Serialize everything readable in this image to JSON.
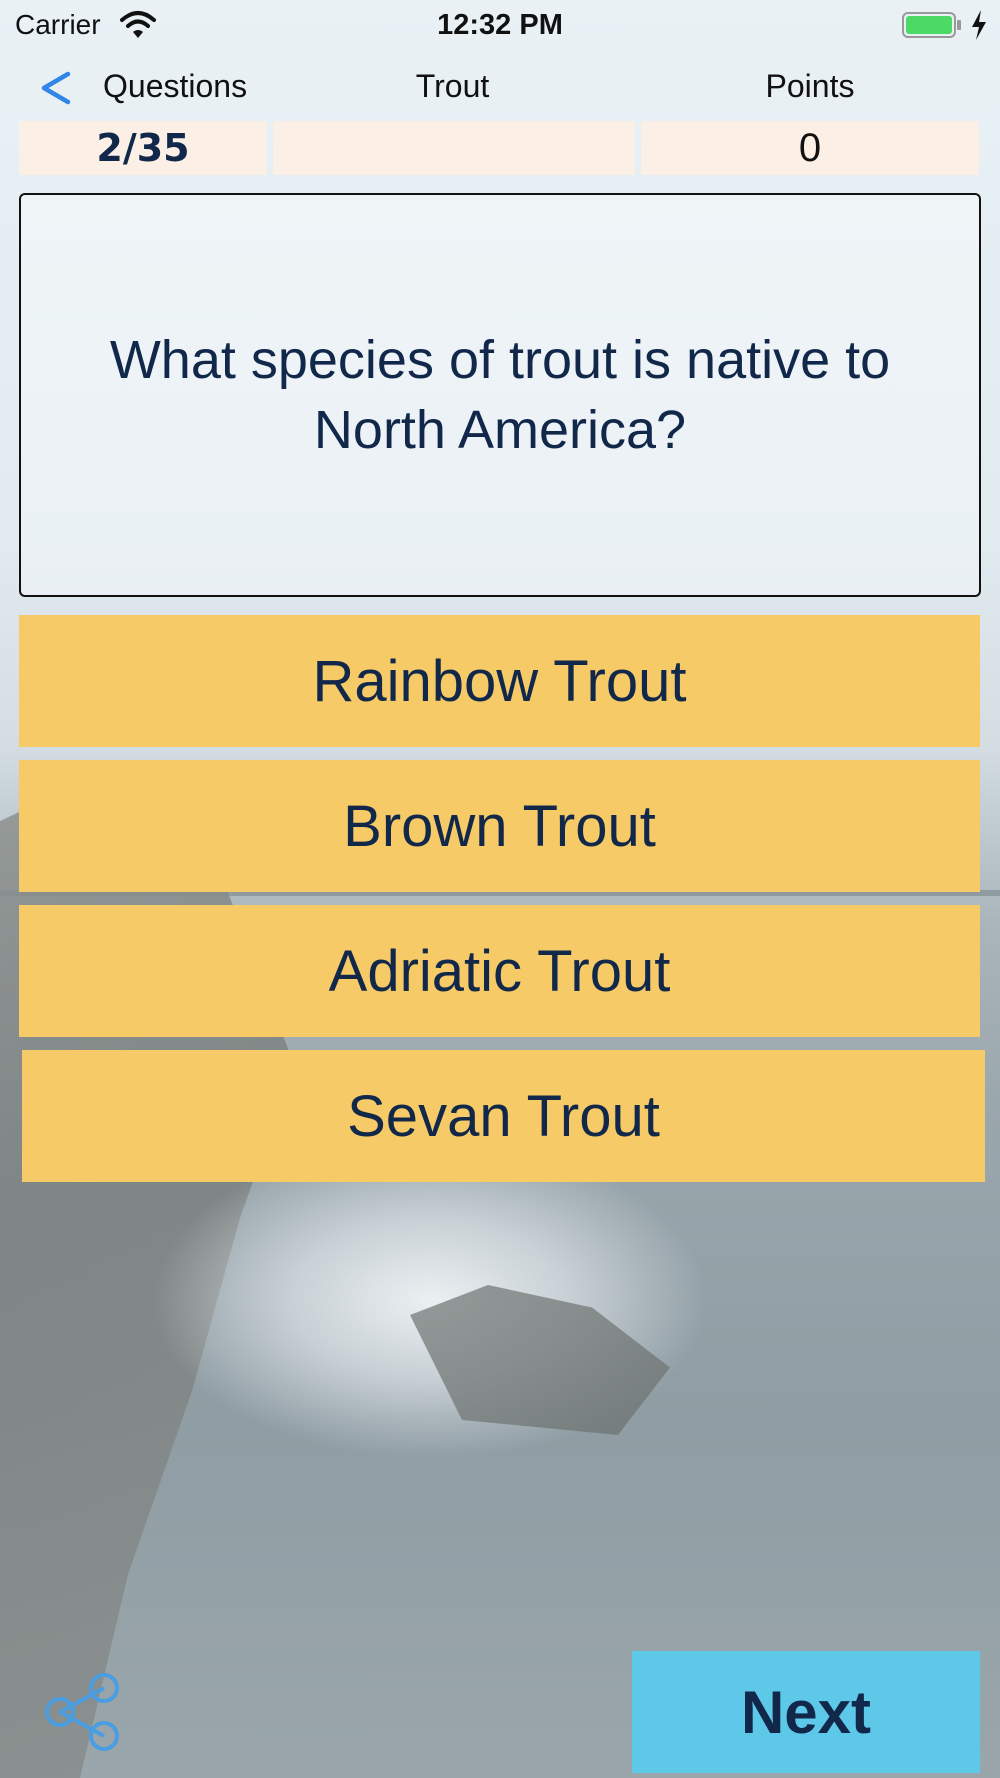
{
  "status_bar": {
    "carrier": "Carrier",
    "time": "12:32 PM"
  },
  "nav": {
    "back_icon": "chevron-left-icon",
    "questions_label": "Questions",
    "title": "Trout",
    "points_label": "Points"
  },
  "stats": {
    "progress": "2/35",
    "points": "0"
  },
  "question": {
    "text": "What species of trout is native to North America?"
  },
  "answers": [
    {
      "label": "Rainbow Trout"
    },
    {
      "label": "Brown Trout"
    },
    {
      "label": "Adriatic Trout"
    },
    {
      "label": "Sevan Trout"
    }
  ],
  "footer": {
    "share_icon": "share-icon",
    "next_label": "Next"
  },
  "colors": {
    "answer_bg": "#f6ca66",
    "next_bg": "#5ec8e8",
    "text_dark": "#12284a",
    "accent_blue": "#2f86e8",
    "stat_bg": "#fbefe6"
  }
}
